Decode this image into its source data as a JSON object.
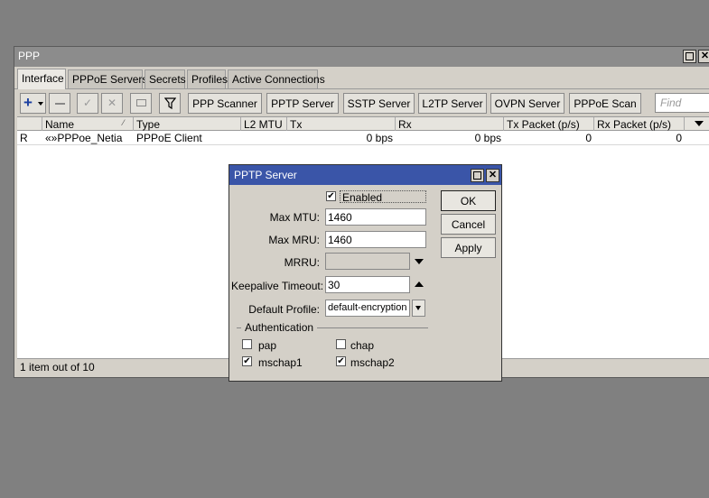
{
  "window": {
    "title": "PPP",
    "tabs": [
      "Interface",
      "PPPoE Servers",
      "Secrets",
      "Profiles",
      "Active Connections"
    ],
    "toolbar": {
      "buttons": [
        "PPP Scanner",
        "PPTP Server",
        "SSTP Server",
        "L2TP Server",
        "OVPN Server",
        "PPPoE Scan"
      ],
      "find_placeholder": "Find"
    },
    "table": {
      "columns": [
        "Name",
        "Type",
        "L2 MTU",
        "Tx",
        "Rx",
        "Tx Packet (p/s)",
        "Rx Packet (p/s)"
      ],
      "rows": [
        {
          "flag": "R",
          "name": "«»PPPoe_Netia",
          "type": "PPPoE Client",
          "l2mtu": "",
          "tx": "0 bps",
          "rx": "0 bps",
          "tx_packet": "0",
          "rx_packet": "0"
        }
      ]
    },
    "status": "1 item out of 10"
  },
  "dialog": {
    "title": "PPTP Server",
    "enabled_label": "Enabled",
    "enabled": true,
    "max_mtu_label": "Max MTU:",
    "max_mtu": "1460",
    "max_mru_label": "Max MRU:",
    "max_mru": "1460",
    "mrru_label": "MRRU:",
    "mrru": "",
    "keepalive_label": "Keepalive Timeout:",
    "keepalive": "30",
    "profile_label": "Default Profile:",
    "profile": "default-encryption",
    "auth_section": "Authentication",
    "auth": {
      "pap": "pap",
      "chap": "chap",
      "mschap1": "mschap1",
      "mschap2": "mschap2"
    },
    "auth_checked": {
      "pap": false,
      "chap": false,
      "mschap1": true,
      "mschap2": true
    },
    "ok": "OK",
    "cancel": "Cancel",
    "apply": "Apply"
  }
}
